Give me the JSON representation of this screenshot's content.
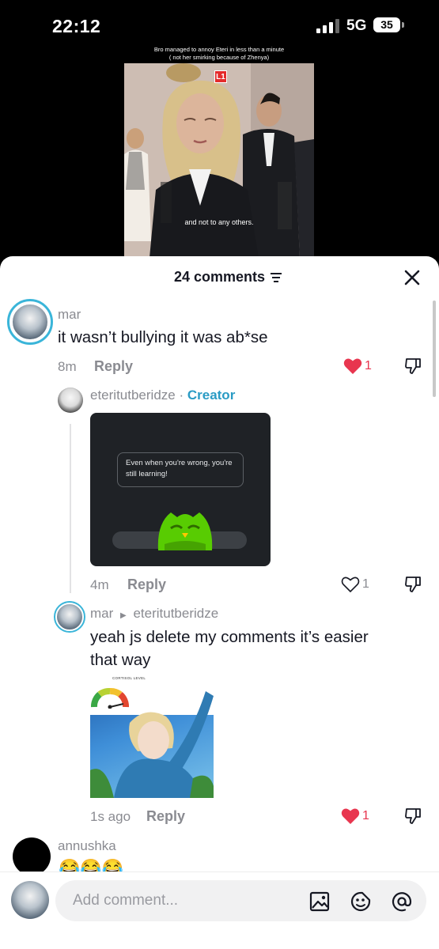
{
  "status_bar": {
    "time": "22:12",
    "network": "5G",
    "battery": "35"
  },
  "video": {
    "caption_line1": "Bro managed to annoy Eteri in less than a minute",
    "caption_line2": "( not her smirking because of Zhenya)",
    "subtitle": "and not to any others.",
    "logo": "L1"
  },
  "comments_header": {
    "title": "24 comments",
    "filter_icon": "sort-lines-icon",
    "close_icon": "close-x-icon"
  },
  "comments": [
    {
      "username": "mar",
      "text": "it wasn’t bullying it was ab*se",
      "time": "8m",
      "reply_label": "Reply",
      "likes": "1",
      "liked": true
    },
    {
      "username": "eteritutberidze",
      "separator": " · ",
      "badge": "Creator",
      "image_text": "Even when you're wrong, you're still learning!",
      "time": "4m",
      "reply_label": "Reply",
      "likes": "1",
      "liked": false
    },
    {
      "username": "mar",
      "reply_to": "eteritutberidze",
      "text_line1": "yeah js delete my comments it’s easier",
      "text_line2": "that way",
      "image_label": "CORTISOL LEVEL",
      "time": "1s ago",
      "reply_label": "Reply",
      "likes": "1",
      "liked": true
    },
    {
      "username": "annushka",
      "text": "😂😂😂"
    }
  ],
  "composer": {
    "placeholder": "Add comment...",
    "icons": [
      "image-icon",
      "emoji-icon",
      "mention-icon"
    ]
  },
  "colors": {
    "accent_creator": "#2a9bc4",
    "like_red": "#e8364f",
    "story_ring": "#3ab5d9"
  }
}
